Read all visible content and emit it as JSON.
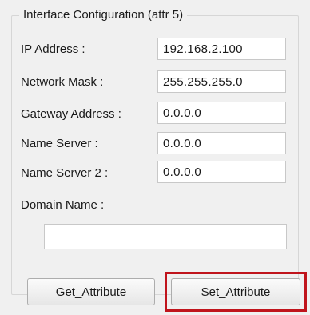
{
  "group": {
    "title": "Interface Configuration (attr 5)"
  },
  "fields": {
    "ip_address": {
      "label": "IP Address :",
      "value": "192.168.2.100"
    },
    "network_mask": {
      "label": "Network Mask :",
      "value": "255.255.255.0"
    },
    "gateway_address": {
      "label": "Gateway Address :",
      "value": "0.0.0.0"
    },
    "name_server": {
      "label": "Name Server :",
      "value": "0.0.0.0"
    },
    "name_server_2": {
      "label": "Name Server 2 :",
      "value": "0.0.0.0"
    },
    "domain_name": {
      "label": "Domain Name :",
      "value": ""
    }
  },
  "buttons": {
    "get_label": "Get_Attribute",
    "set_label": "Set_Attribute"
  },
  "highlight": {
    "target": "set-attribute-button",
    "color": "#c0141c"
  }
}
